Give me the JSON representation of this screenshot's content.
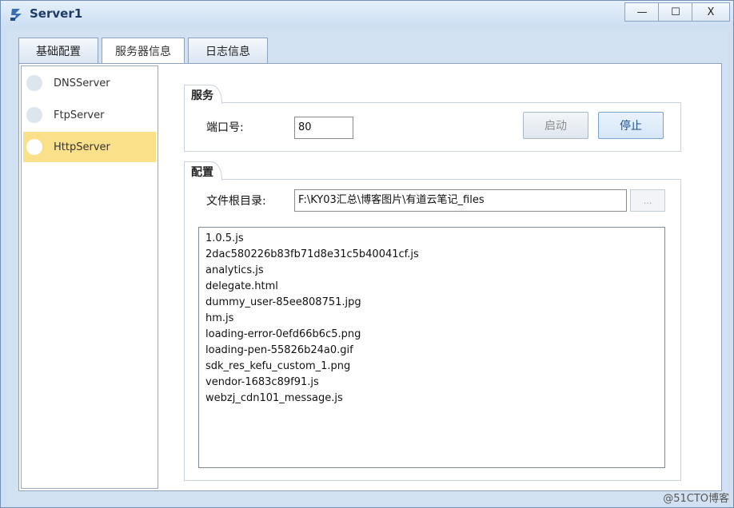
{
  "window": {
    "title": "Server1"
  },
  "controls": {
    "minimize": "—",
    "maximize": "☐",
    "close": "X"
  },
  "tabs": [
    "基础配置",
    "服务器信息",
    "日志信息"
  ],
  "servers": [
    {
      "label": "DNSServer",
      "active": false
    },
    {
      "label": "FtpServer",
      "active": false
    },
    {
      "label": "HttpServer",
      "active": true
    }
  ],
  "service_group": {
    "title": "服务",
    "port_label": "端口号:",
    "port_value": "80",
    "start_label": "启动",
    "stop_label": "停止"
  },
  "config_group": {
    "title": "配置",
    "root_label": "文件根目录:",
    "root_value": "F:\\KY03汇总\\博客图片\\有道云笔记_files",
    "browse_label": "...",
    "files": [
      "1.0.5.js",
      "2dac580226b83fb71d8e31c5b40041cf.js",
      "analytics.js",
      "delegate.html",
      "dummy_user-85ee808751.jpg",
      "hm.js",
      "loading-error-0efd66b6c5.png",
      "loading-pen-55826b24a0.gif",
      "sdk_res_kefu_custom_1.png",
      "vendor-1683c89f91.js",
      "webzj_cdn101_message.js"
    ]
  },
  "watermark": "@51CTO博客"
}
